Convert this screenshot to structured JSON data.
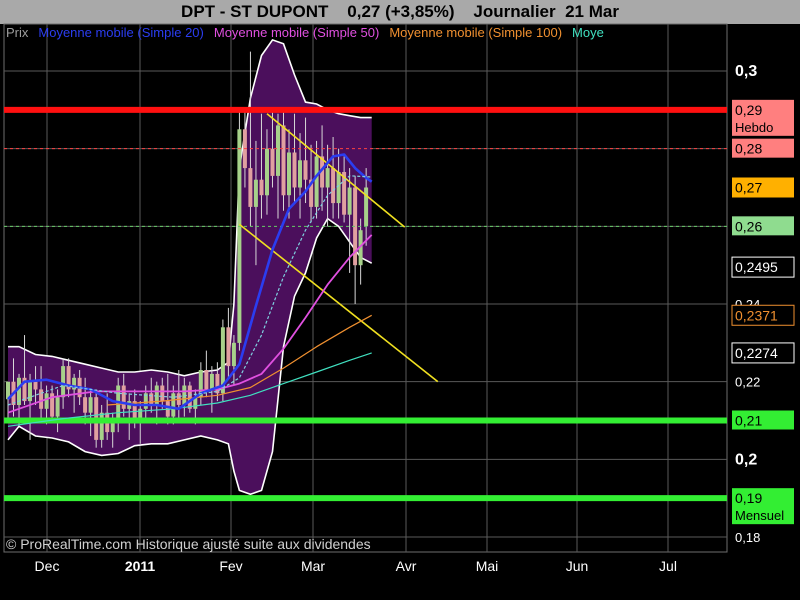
{
  "header": {
    "title": "DPT - ST DUPONT    0,27 (+3,85%)    Journalier  21 Mar"
  },
  "footer": {
    "copyright": "© ProRealTime.com Historique ajusté suite aux dividendes"
  },
  "chart_data": {
    "type": "candlestick",
    "x_ticks": [
      "Dec",
      "2011",
      "Fev",
      "Mar",
      "Avr",
      "Mai",
      "Jun",
      "Jul"
    ],
    "ylim": [
      0.177,
      0.312
    ],
    "y_ticks": [
      {
        "value": 0.3,
        "label": "0,3",
        "bold": true
      },
      {
        "value": 0.28,
        "label": "",
        "bold": false
      },
      {
        "value": 0.26,
        "label": "",
        "bold": false
      },
      {
        "value": 0.24,
        "label": "0,24",
        "bold": false
      },
      {
        "value": 0.22,
        "label": "0,22",
        "bold": false
      },
      {
        "value": 0.2,
        "label": "0,2",
        "bold": true
      },
      {
        "value": 0.18,
        "label": "0,18",
        "bold": false
      }
    ],
    "legend": [
      {
        "name": "Prix",
        "color": "#9e9e9e"
      },
      {
        "name": "Moyenne mobile (Simple 20)",
        "color": "#2b3df0"
      },
      {
        "name": "Moyenne mobile (Simple 50)",
        "color": "#e050e0"
      },
      {
        "name": "Moyenne mobile (Simple 100)",
        "color": "#f09030"
      },
      {
        "name": "Moye",
        "color": "#40e0c0"
      }
    ],
    "horizontal_levels": [
      {
        "value": 0.29,
        "color": "#ff1010",
        "style": "solid",
        "label": "0,29",
        "sub_label": "Hebdo",
        "label_bg": "#ff7f7f",
        "label_fg": "#000000"
      },
      {
        "value": 0.28,
        "color": "#ff4040",
        "style": "dashed",
        "label": "0,28",
        "label_bg": "#ff7f7f",
        "label_fg": "#000000"
      },
      {
        "value": 0.26,
        "color": "#66cc66",
        "style": "dashed",
        "label": "0,26",
        "label_bg": "#8fdc8f",
        "label_fg": "#000000"
      },
      {
        "value": 0.21,
        "color": "#33ee33",
        "style": "solid",
        "label": "0,21",
        "label_bg": "#33ee33",
        "label_fg": "#000000"
      },
      {
        "value": 0.19,
        "color": "#33ee33",
        "style": "solid",
        "label": "0,19",
        "sub_label": "Mensuel",
        "label_bg": "#33ee33",
        "label_fg": "#000000"
      }
    ],
    "axis_badges": [
      {
        "value": 0.27,
        "label": "0,27",
        "bg": "#ffb000",
        "fg": "#000000"
      },
      {
        "value": 0.2495,
        "label": "0,2495",
        "bg": "#000000",
        "fg": "#ffffff",
        "border": "#ffffff"
      },
      {
        "value": 0.2371,
        "label": "0,2371",
        "bg": "#000000",
        "fg": "#f09030",
        "border": "#f09030"
      },
      {
        "value": 0.2274,
        "label": "0,2274",
        "bg": "#000000",
        "fg": "#ffffff",
        "border": "#ffffff"
      }
    ],
    "candles": [
      {
        "o": 0.2155,
        "h": 0.2175,
        "l": 0.21,
        "c": 0.22
      },
      {
        "o": 0.22,
        "h": 0.226,
        "l": 0.211,
        "c": 0.214
      },
      {
        "o": 0.214,
        "h": 0.222,
        "l": 0.209,
        "c": 0.221
      },
      {
        "o": 0.221,
        "h": 0.232,
        "l": 0.214,
        "c": 0.215
      },
      {
        "o": 0.215,
        "h": 0.222,
        "l": 0.205,
        "c": 0.22
      },
      {
        "o": 0.22,
        "h": 0.224,
        "l": 0.214,
        "c": 0.218
      },
      {
        "o": 0.218,
        "h": 0.224,
        "l": 0.21,
        "c": 0.213
      },
      {
        "o": 0.213,
        "h": 0.219,
        "l": 0.209,
        "c": 0.217
      },
      {
        "o": 0.217,
        "h": 0.219,
        "l": 0.21,
        "c": 0.211
      },
      {
        "o": 0.211,
        "h": 0.218,
        "l": 0.207,
        "c": 0.216
      },
      {
        "o": 0.216,
        "h": 0.226,
        "l": 0.213,
        "c": 0.224
      },
      {
        "o": 0.224,
        "h": 0.226,
        "l": 0.216,
        "c": 0.218
      },
      {
        "o": 0.218,
        "h": 0.222,
        "l": 0.212,
        "c": 0.221
      },
      {
        "o": 0.221,
        "h": 0.223,
        "l": 0.214,
        "c": 0.216
      },
      {
        "o": 0.216,
        "h": 0.221,
        "l": 0.209,
        "c": 0.212
      },
      {
        "o": 0.212,
        "h": 0.218,
        "l": 0.206,
        "c": 0.216
      },
      {
        "o": 0.216,
        "h": 0.218,
        "l": 0.203,
        "c": 0.205
      },
      {
        "o": 0.205,
        "h": 0.214,
        "l": 0.203,
        "c": 0.212
      },
      {
        "o": 0.212,
        "h": 0.217,
        "l": 0.205,
        "c": 0.207
      },
      {
        "o": 0.207,
        "h": 0.212,
        "l": 0.203,
        "c": 0.21
      },
      {
        "o": 0.21,
        "h": 0.221,
        "l": 0.207,
        "c": 0.219
      },
      {
        "o": 0.219,
        "h": 0.222,
        "l": 0.211,
        "c": 0.213
      },
      {
        "o": 0.213,
        "h": 0.217,
        "l": 0.205,
        "c": 0.215
      },
      {
        "o": 0.215,
        "h": 0.218,
        "l": 0.208,
        "c": 0.21
      },
      {
        "o": 0.21,
        "h": 0.215,
        "l": 0.204,
        "c": 0.213
      },
      {
        "o": 0.213,
        "h": 0.219,
        "l": 0.21,
        "c": 0.217
      },
      {
        "o": 0.217,
        "h": 0.221,
        "l": 0.212,
        "c": 0.214
      },
      {
        "o": 0.214,
        "h": 0.22,
        "l": 0.209,
        "c": 0.219
      },
      {
        "o": 0.219,
        "h": 0.221,
        "l": 0.213,
        "c": 0.215
      },
      {
        "o": 0.215,
        "h": 0.222,
        "l": 0.209,
        "c": 0.211
      },
      {
        "o": 0.211,
        "h": 0.219,
        "l": 0.209,
        "c": 0.217
      },
      {
        "o": 0.217,
        "h": 0.223,
        "l": 0.21,
        "c": 0.214
      },
      {
        "o": 0.214,
        "h": 0.221,
        "l": 0.211,
        "c": 0.219
      },
      {
        "o": 0.219,
        "h": 0.22,
        "l": 0.212,
        "c": 0.213
      },
      {
        "o": 0.213,
        "h": 0.218,
        "l": 0.209,
        "c": 0.216
      },
      {
        "o": 0.216,
        "h": 0.225,
        "l": 0.214,
        "c": 0.223
      },
      {
        "o": 0.223,
        "h": 0.228,
        "l": 0.216,
        "c": 0.218
      },
      {
        "o": 0.218,
        "h": 0.224,
        "l": 0.212,
        "c": 0.222
      },
      {
        "o": 0.222,
        "h": 0.225,
        "l": 0.215,
        "c": 0.217
      },
      {
        "o": 0.217,
        "h": 0.236,
        "l": 0.215,
        "c": 0.234
      },
      {
        "o": 0.234,
        "h": 0.239,
        "l": 0.221,
        "c": 0.224
      },
      {
        "o": 0.224,
        "h": 0.232,
        "l": 0.219,
        "c": 0.23
      },
      {
        "o": 0.23,
        "h": 0.29,
        "l": 0.228,
        "c": 0.285
      },
      {
        "o": 0.285,
        "h": 0.29,
        "l": 0.27,
        "c": 0.275
      },
      {
        "o": 0.275,
        "h": 0.305,
        "l": 0.26,
        "c": 0.265
      },
      {
        "o": 0.265,
        "h": 0.282,
        "l": 0.25,
        "c": 0.272
      },
      {
        "o": 0.272,
        "h": 0.289,
        "l": 0.262,
        "c": 0.268
      },
      {
        "o": 0.268,
        "h": 0.285,
        "l": 0.263,
        "c": 0.28
      },
      {
        "o": 0.28,
        "h": 0.29,
        "l": 0.27,
        "c": 0.273
      },
      {
        "o": 0.273,
        "h": 0.289,
        "l": 0.262,
        "c": 0.286
      },
      {
        "o": 0.286,
        "h": 0.29,
        "l": 0.264,
        "c": 0.268
      },
      {
        "o": 0.268,
        "h": 0.285,
        "l": 0.262,
        "c": 0.279
      },
      {
        "o": 0.279,
        "h": 0.289,
        "l": 0.266,
        "c": 0.27
      },
      {
        "o": 0.27,
        "h": 0.284,
        "l": 0.262,
        "c": 0.277
      },
      {
        "o": 0.277,
        "h": 0.288,
        "l": 0.266,
        "c": 0.272
      },
      {
        "o": 0.272,
        "h": 0.281,
        "l": 0.261,
        "c": 0.265
      },
      {
        "o": 0.265,
        "h": 0.282,
        "l": 0.262,
        "c": 0.278
      },
      {
        "o": 0.278,
        "h": 0.286,
        "l": 0.264,
        "c": 0.27
      },
      {
        "o": 0.27,
        "h": 0.281,
        "l": 0.26,
        "c": 0.275
      },
      {
        "o": 0.275,
        "h": 0.283,
        "l": 0.262,
        "c": 0.266
      },
      {
        "o": 0.266,
        "h": 0.28,
        "l": 0.262,
        "c": 0.274
      },
      {
        "o": 0.274,
        "h": 0.278,
        "l": 0.261,
        "c": 0.263
      },
      {
        "o": 0.263,
        "h": 0.275,
        "l": 0.248,
        "c": 0.27
      },
      {
        "o": 0.27,
        "h": 0.273,
        "l": 0.24,
        "c": 0.25
      },
      {
        "o": 0.25,
        "h": 0.262,
        "l": 0.245,
        "c": 0.259
      },
      {
        "o": 0.26,
        "h": 0.275,
        "l": 0.255,
        "c": 0.27
      }
    ],
    "moving_averages": [
      {
        "name": "Moyenne mobile (Simple 20)",
        "color": "#2b3df0",
        "width": 2.6,
        "points": [
          [
            0,
            0.2155
          ],
          [
            3,
            0.22
          ],
          [
            7,
            0.2205
          ],
          [
            11,
            0.219
          ],
          [
            15,
            0.218
          ],
          [
            19,
            0.215
          ],
          [
            23,
            0.214
          ],
          [
            27,
            0.214
          ],
          [
            31,
            0.213
          ],
          [
            35,
            0.217
          ],
          [
            39,
            0.219
          ],
          [
            42,
            0.2245
          ],
          [
            45,
            0.2395
          ],
          [
            48,
            0.254
          ],
          [
            51,
            0.2645
          ],
          [
            54,
            0.269
          ],
          [
            56,
            0.273
          ],
          [
            59,
            0.278
          ],
          [
            61,
            0.2785
          ],
          [
            63,
            0.275
          ],
          [
            65,
            0.2725
          ],
          [
            66,
            0.2715
          ]
        ]
      },
      {
        "name": "Moyenne mobile (Simple 50)",
        "color": "#e050e0",
        "width": 1.8,
        "points": [
          [
            0,
            0.212
          ],
          [
            8,
            0.216
          ],
          [
            16,
            0.2175
          ],
          [
            24,
            0.2175
          ],
          [
            32,
            0.2175
          ],
          [
            38,
            0.218
          ],
          [
            42,
            0.2195
          ],
          [
            46,
            0.222
          ],
          [
            50,
            0.2285
          ],
          [
            54,
            0.2365
          ],
          [
            58,
            0.245
          ],
          [
            62,
            0.252
          ],
          [
            66,
            0.2578
          ]
        ]
      },
      {
        "name": "Moyenne mobile (Simple 100)",
        "color": "#f09030",
        "width": 1.2,
        "points": [
          [
            18,
            0.214
          ],
          [
            28,
            0.215
          ],
          [
            38,
            0.2165
          ],
          [
            44,
            0.2185
          ],
          [
            50,
            0.2235
          ],
          [
            56,
            0.229
          ],
          [
            62,
            0.234
          ],
          [
            66,
            0.2371
          ]
        ]
      },
      {
        "name": "Moye",
        "color": "#40e0c0",
        "width": 1.2,
        "points": [
          [
            0,
            0.2085
          ],
          [
            10,
            0.2105
          ],
          [
            20,
            0.212
          ],
          [
            30,
            0.213
          ],
          [
            38,
            0.2145
          ],
          [
            44,
            0.2165
          ],
          [
            50,
            0.2195
          ],
          [
            56,
            0.2225
          ],
          [
            62,
            0.2255
          ],
          [
            66,
            0.2274
          ]
        ]
      }
    ],
    "dashed_ma": {
      "color": "#7fd0e0",
      "points": [
        [
          0,
          0.214
        ],
        [
          10,
          0.219
        ],
        [
          20,
          0.217
        ],
        [
          30,
          0.216
        ],
        [
          38,
          0.2175
        ],
        [
          42,
          0.221
        ],
        [
          46,
          0.232
        ],
        [
          50,
          0.247
        ],
        [
          54,
          0.259
        ],
        [
          58,
          0.268
        ],
        [
          62,
          0.273
        ],
        [
          66,
          0.2727
        ]
      ]
    },
    "bollinger": {
      "upper": [
        [
          0,
          0.229
        ],
        [
          2,
          0.229
        ],
        [
          5,
          0.227
        ],
        [
          8,
          0.2265
        ],
        [
          11,
          0.2255
        ],
        [
          14,
          0.2245
        ],
        [
          17,
          0.2235
        ],
        [
          20,
          0.2225
        ],
        [
          23,
          0.2225
        ],
        [
          26,
          0.223
        ],
        [
          29,
          0.2225
        ],
        [
          32,
          0.2215
        ],
        [
          35,
          0.2225
        ],
        [
          38,
          0.223
        ],
        [
          40,
          0.225
        ],
        [
          41,
          0.24
        ],
        [
          42,
          0.275
        ],
        [
          44,
          0.293
        ],
        [
          46,
          0.304
        ],
        [
          48,
          0.308
        ],
        [
          50,
          0.307
        ],
        [
          52,
          0.299
        ],
        [
          54,
          0.292
        ],
        [
          56,
          0.2915
        ],
        [
          58,
          0.29
        ],
        [
          60,
          0.289
        ],
        [
          62,
          0.2885
        ],
        [
          64,
          0.288
        ],
        [
          66,
          0.288
        ]
      ],
      "lower": [
        [
          0,
          0.205
        ],
        [
          2,
          0.2085
        ],
        [
          5,
          0.206
        ],
        [
          8,
          0.2055
        ],
        [
          11,
          0.2045
        ],
        [
          14,
          0.202
        ],
        [
          17,
          0.201
        ],
        [
          20,
          0.2015
        ],
        [
          23,
          0.2035
        ],
        [
          26,
          0.204
        ],
        [
          29,
          0.204
        ],
        [
          32,
          0.205
        ],
        [
          35,
          0.206
        ],
        [
          38,
          0.205
        ],
        [
          40,
          0.204
        ],
        [
          41,
          0.197
        ],
        [
          42,
          0.192
        ],
        [
          44,
          0.191
        ],
        [
          46,
          0.192
        ],
        [
          48,
          0.202
        ],
        [
          50,
          0.229
        ],
        [
          52,
          0.242
        ],
        [
          54,
          0.248
        ],
        [
          56,
          0.257
        ],
        [
          58,
          0.262
        ],
        [
          60,
          0.26
        ],
        [
          62,
          0.256
        ],
        [
          64,
          0.252
        ],
        [
          66,
          0.2505
        ]
      ]
    },
    "trendlines": [
      {
        "color": "#f0e020",
        "from": [
          47,
          0.289
        ],
        "to": [
          72,
          0.2598
        ]
      },
      {
        "color": "#f0e020",
        "from": [
          42,
          0.2605
        ],
        "to": [
          78,
          0.22
        ]
      }
    ]
  }
}
